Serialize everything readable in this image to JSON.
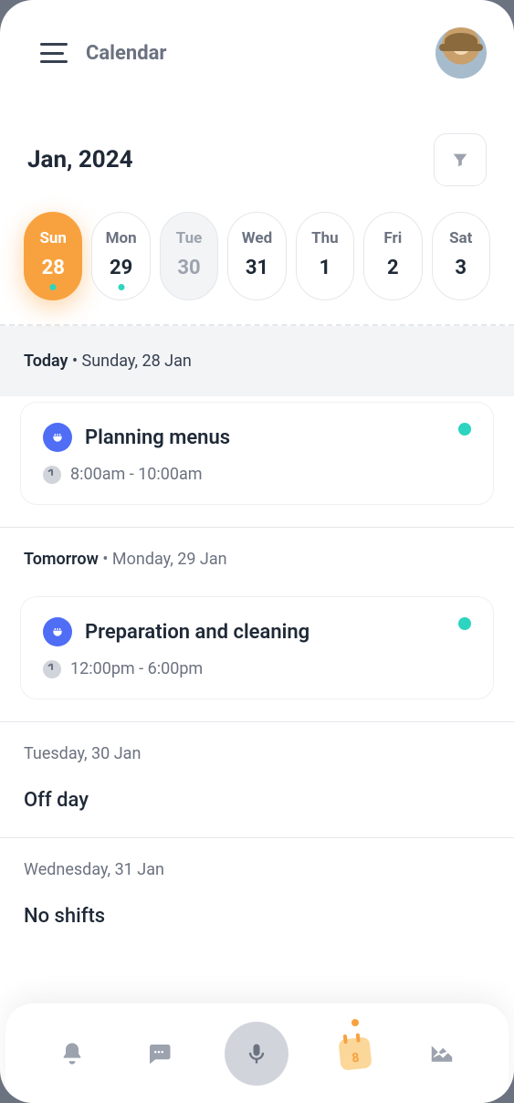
{
  "header": {
    "title": "Calendar"
  },
  "month": {
    "label": "Jan, 2024"
  },
  "week": [
    {
      "name": "Sun",
      "date": "28",
      "selected": true,
      "muted": false,
      "dot": true
    },
    {
      "name": "Mon",
      "date": "29",
      "selected": false,
      "muted": false,
      "dot": true
    },
    {
      "name": "Tue",
      "date": "30",
      "selected": false,
      "muted": true,
      "dot": false
    },
    {
      "name": "Wed",
      "date": "31",
      "selected": false,
      "muted": false,
      "dot": false
    },
    {
      "name": "Thu",
      "date": "1",
      "selected": false,
      "muted": false,
      "dot": false
    },
    {
      "name": "Fri",
      "date": "2",
      "selected": false,
      "muted": false,
      "dot": false
    },
    {
      "name": "Sat",
      "date": "3",
      "selected": false,
      "muted": false,
      "dot": false
    }
  ],
  "sections": {
    "today": {
      "lead": "Today",
      "sep": "  •  ",
      "date": "Sunday, 28 Jan",
      "task_title": "Planning menus",
      "task_time": "8:00am - 10:00am"
    },
    "tomorrow": {
      "lead": "Tomorrow",
      "sep": "  •  ",
      "date": "Monday, 29 Jan",
      "task_title": "Preparation and cleaning",
      "task_time": "12:00pm - 6:00pm"
    },
    "tue": {
      "date": "Tuesday, 30 Jan",
      "body": "Off day"
    },
    "wed": {
      "date": "Wednesday, 31 Jan",
      "body": "No shifts"
    }
  },
  "nav": {
    "active_index": 3,
    "calendar_badge": "8"
  },
  "colors": {
    "accent": "#f8a23f",
    "teal": "#2dd4bf",
    "task_blue": "#4f6df5"
  }
}
